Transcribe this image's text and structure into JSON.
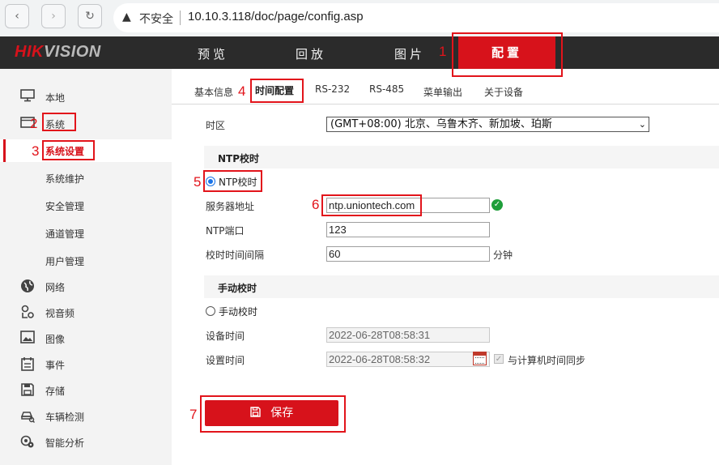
{
  "browser": {
    "back_icon": "back-arrow-icon",
    "forward_icon": "forward-arrow-icon",
    "reload_icon": "reload-icon",
    "security_text": "不安全",
    "url": "10.10.3.118/doc/page/config.asp"
  },
  "topnav": {
    "logo_red": "HIK",
    "logo_gray": "VISION",
    "items": [
      "预览",
      "回放",
      "图片",
      "配置"
    ],
    "active_index": 3
  },
  "annotations": [
    "1",
    "2",
    "3",
    "4",
    "5",
    "6",
    "7"
  ],
  "sidebar": {
    "items": [
      {
        "label": "本地",
        "icon": "monitor-icon"
      },
      {
        "label": "系统",
        "icon": "system-icon"
      },
      {
        "label": "系统设置",
        "icon": ""
      },
      {
        "label": "系统维护",
        "icon": ""
      },
      {
        "label": "安全管理",
        "icon": ""
      },
      {
        "label": "通道管理",
        "icon": ""
      },
      {
        "label": "用户管理",
        "icon": ""
      },
      {
        "label": "网络",
        "icon": "globe-icon"
      },
      {
        "label": "视音频",
        "icon": "audio-video-icon"
      },
      {
        "label": "图像",
        "icon": "image-icon"
      },
      {
        "label": "事件",
        "icon": "calendar-icon"
      },
      {
        "label": "存储",
        "icon": "floppy-icon"
      },
      {
        "label": "车辆检测",
        "icon": "vehicle-icon"
      },
      {
        "label": "智能分析",
        "icon": "smart-analysis-icon"
      }
    ],
    "selected_index": 2
  },
  "tabs": [
    "基本信息",
    "时间配置",
    "RS-232",
    "RS-485",
    "菜单输出",
    "关于设备"
  ],
  "active_tab": 1,
  "form": {
    "timezone_label": "时区",
    "timezone_value": "(GMT+08:00) 北京、乌鲁木齐、新加坡、珀斯",
    "ntp_section": "NTP校时",
    "ntp_radio_label": "NTP校时",
    "server_label": "服务器地址",
    "server_value": "ntp.uniontech.com",
    "port_label": "NTP端口",
    "port_value": "123",
    "interval_label": "校时时间间隔",
    "interval_value": "60",
    "interval_unit": "分钟",
    "manual_section": "手动校时",
    "manual_radio_label": "手动校时",
    "device_time_label": "设备时间",
    "device_time_value": "2022-06-28T08:58:31",
    "set_time_label": "设置时间",
    "set_time_value": "2022-06-28T08:58:32",
    "sync_label": "与计算机时间同步",
    "save_label": "保存"
  },
  "colors": {
    "accent": "#d7121b",
    "annotation": "#e2141b",
    "nav_bg": "#2b2b2b"
  }
}
